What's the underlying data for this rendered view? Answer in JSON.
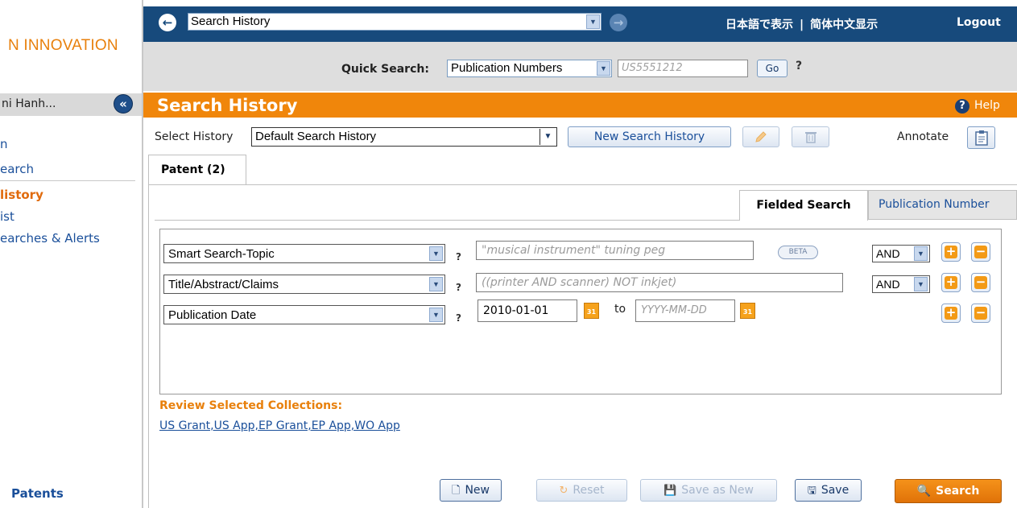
{
  "sidebar": {
    "brand": "N INNOVATION",
    "user_name": "ni Hanh...",
    "collapse_glyph": "«",
    "items": [
      {
        "label": "n",
        "active": false
      },
      {
        "label": "earch",
        "active": false
      },
      {
        "label": "listory",
        "active": true
      },
      {
        "label": "ist",
        "active": false
      },
      {
        "label": "earches & Alerts",
        "active": false
      }
    ],
    "footer": "Patents"
  },
  "header": {
    "history_select": "Search History",
    "lang_japanese": "日本語で表示",
    "lang_separator": "|",
    "lang_chinese": "简体中文显示",
    "logout": "Logout"
  },
  "quick_search": {
    "label": "Quick Search:",
    "type": "Publication Numbers",
    "placeholder": "US5551212",
    "go": "Go",
    "help": "?"
  },
  "title_bar": {
    "title": "Search History",
    "help": "Help"
  },
  "history_row": {
    "label": "Select History",
    "selected": "Default Search History",
    "new_button": "New Search History",
    "annotate": "Annotate"
  },
  "tabs": {
    "patent": "Patent (2)",
    "fielded": "Fielded Search",
    "publication": "Publication Number"
  },
  "fields": [
    {
      "field": "Smart Search-Topic",
      "placeholder": "\"musical instrument\" tuning peg",
      "operator": "AND",
      "badge": "BETA"
    },
    {
      "field": "Title/Abstract/Claims",
      "placeholder": "((printer AND scanner) NOT inkjet)",
      "operator": "AND"
    },
    {
      "field": "Publication Date",
      "date_from": "2010-01-01",
      "to": "to",
      "date_to_placeholder": "YYYY-MM-DD"
    }
  ],
  "help_mark": "?",
  "calendar_text": "31",
  "review": {
    "label": "Review Selected Collections:",
    "collections": "US Grant,US App,EP Grant,EP App,WO App"
  },
  "actions": {
    "new": "New",
    "reset": "Reset",
    "save_as_new": "Save as New",
    "save": "Save",
    "search": "Search"
  },
  "colors": {
    "header_blue": "#174a7c",
    "title_orange": "#f0860b",
    "link_blue": "#1a4f9a",
    "accent_orange": "#e8800c"
  }
}
